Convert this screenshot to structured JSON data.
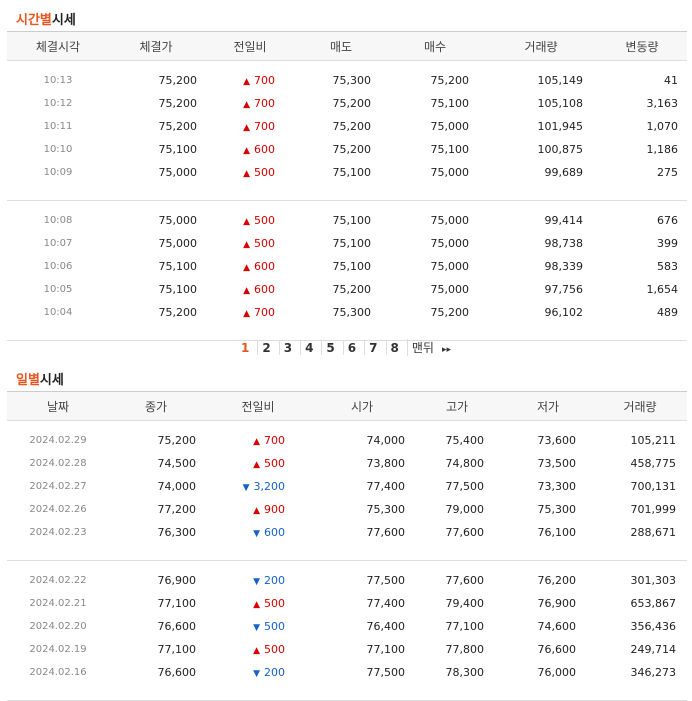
{
  "time_section": {
    "title_highlight": "시간별",
    "title_rest": "시세",
    "headers": [
      "체결시각",
      "체결가",
      "전일비",
      "매도",
      "매수",
      "거래량",
      "변동량"
    ],
    "rows": [
      [
        "10:13",
        "75,200",
        "700",
        "75,300",
        "75,200",
        "105,149",
        "41"
      ],
      [
        "10:12",
        "75,200",
        "700",
        "75,200",
        "75,100",
        "105,108",
        "3,163"
      ],
      [
        "10:11",
        "75,200",
        "700",
        "75,200",
        "75,000",
        "101,945",
        "1,070"
      ],
      [
        "10:10",
        "75,100",
        "600",
        "75,200",
        "75,100",
        "100,875",
        "1,186"
      ],
      [
        "10:09",
        "75,000",
        "500",
        "75,100",
        "75,000",
        "99,689",
        "275"
      ],
      [
        "10:08",
        "75,000",
        "500",
        "75,100",
        "75,000",
        "99,414",
        "676"
      ],
      [
        "10:07",
        "75,000",
        "500",
        "75,100",
        "75,000",
        "98,738",
        "399"
      ],
      [
        "10:06",
        "75,100",
        "600",
        "75,100",
        "75,000",
        "98,339",
        "583"
      ],
      [
        "10:05",
        "75,100",
        "600",
        "75,200",
        "75,000",
        "97,756",
        "1,654"
      ],
      [
        "10:04",
        "75,200",
        "700",
        "75,300",
        "75,200",
        "96,102",
        "489"
      ]
    ],
    "directions": [
      "up",
      "up",
      "up",
      "up",
      "up",
      "up",
      "up",
      "up",
      "up",
      "up"
    ]
  },
  "pagination": {
    "pages": [
      "1",
      "2",
      "3",
      "4",
      "5",
      "6",
      "7",
      "8"
    ],
    "current": "1",
    "last_label": "맨뒤",
    "last_icon": "double-chevron-right-icon"
  },
  "daily_section": {
    "title_highlight": "일별",
    "title_rest": "시세",
    "headers": [
      "날짜",
      "종가",
      "전일비",
      "시가",
      "고가",
      "저가",
      "거래량"
    ],
    "rows": [
      [
        "2024.02.29",
        "75,200",
        "700",
        "74,000",
        "75,400",
        "73,600",
        "105,211"
      ],
      [
        "2024.02.28",
        "74,500",
        "500",
        "73,800",
        "74,800",
        "73,500",
        "458,775"
      ],
      [
        "2024.02.27",
        "74,000",
        "3,200",
        "77,400",
        "77,500",
        "73,300",
        "700,131"
      ],
      [
        "2024.02.26",
        "77,200",
        "900",
        "75,300",
        "79,000",
        "75,300",
        "701,999"
      ],
      [
        "2024.02.23",
        "76,300",
        "600",
        "77,600",
        "77,600",
        "76,100",
        "288,671"
      ],
      [
        "2024.02.22",
        "76,900",
        "200",
        "77,500",
        "77,600",
        "76,200",
        "301,303"
      ],
      [
        "2024.02.21",
        "77,100",
        "500",
        "77,400",
        "79,400",
        "76,900",
        "653,867"
      ],
      [
        "2024.02.20",
        "76,600",
        "500",
        "76,400",
        "77,100",
        "74,600",
        "356,436"
      ],
      [
        "2024.02.19",
        "77,100",
        "500",
        "77,100",
        "77,800",
        "76,600",
        "249,714"
      ],
      [
        "2024.02.16",
        "76,600",
        "200",
        "77,500",
        "78,300",
        "76,000",
        "346,273"
      ]
    ],
    "directions": [
      "up",
      "up",
      "down",
      "up",
      "down",
      "down",
      "up",
      "down",
      "up",
      "down"
    ]
  },
  "colors": {
    "up": "#d60000",
    "down": "#1561c9",
    "accent": "#e8541e"
  }
}
